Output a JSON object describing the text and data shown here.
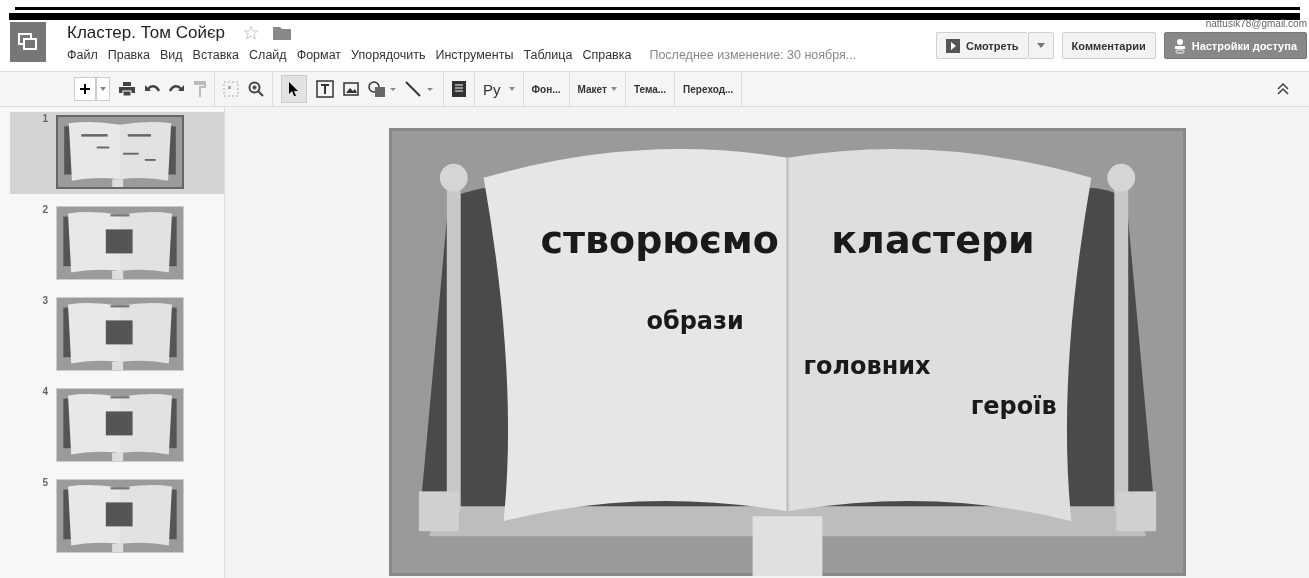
{
  "app": {
    "title": "Кластер. Том Сойєр",
    "starred": false,
    "account": "nattusik78@gmail.com"
  },
  "menu": [
    "Файл",
    "Правка",
    "Вид",
    "Вставка",
    "Слайд",
    "Формат",
    "Упорядочить",
    "Инструменты",
    "Таблица",
    "Справка"
  ],
  "last_edit": "Последнее изменение: 30 ноября...",
  "buttons": {
    "present": "Смотреть",
    "comments": "Комментарии",
    "share": "Настройки доступа"
  },
  "toolbar": {
    "font": "Ру",
    "items": [
      {
        "label": "Фон...",
        "dropdown": false
      },
      {
        "label": "Макет",
        "dropdown": true
      },
      {
        "label": "Тема...",
        "dropdown": false
      },
      {
        "label": "Переход...",
        "dropdown": false
      }
    ]
  },
  "slides": [
    {
      "number": "1",
      "selected": true,
      "kind": "cluster"
    },
    {
      "number": "2",
      "selected": false,
      "kind": "photo"
    },
    {
      "number": "3",
      "selected": false,
      "kind": "photo"
    },
    {
      "number": "4",
      "selected": false,
      "kind": "photo"
    },
    {
      "number": "5",
      "selected": false,
      "kind": "photo"
    }
  ],
  "slide": {
    "texts": [
      {
        "text": "створюємо",
        "kind": "heading"
      },
      {
        "text": "кластери",
        "kind": "heading"
      },
      {
        "text": "образи",
        "kind": "body"
      },
      {
        "text": "головних",
        "kind": "body"
      },
      {
        "text": "героїв",
        "kind": "body"
      }
    ]
  }
}
